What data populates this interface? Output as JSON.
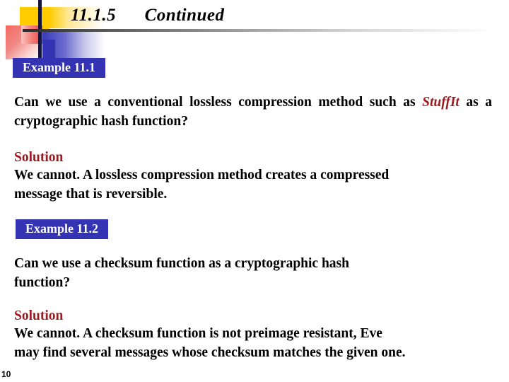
{
  "slide": {
    "title": "11.1.5      Continued",
    "page_number": "10",
    "accent_blue": "#3333B3",
    "accent_yellow": "#FFCC00",
    "accent_red": "#EC4B44",
    "heading_red": "#9C1B21"
  },
  "blocks": {
    "example_1": {
      "label": "Example 11.1",
      "question_part_a": "Can we use a conventional lossless compression method such as ",
      "question_brand": "StuffIt",
      "question_part_b": " as a cryptographic hash function?",
      "solution_heading": "Solution",
      "solution_line_1": "We cannot. A lossless compression method creates a compressed",
      "solution_line_2": "message that is reversible."
    },
    "example_2": {
      "label": "Example 11.2",
      "question_line_1": "Can we use a checksum function as a cryptographic hash",
      "question_line_2": "function?",
      "solution_heading": "Solution",
      "solution_line_1": "We cannot. A checksum function is not preimage resistant, Eve",
      "solution_line_2": "may find several messages whose checksum matches the given one."
    }
  }
}
